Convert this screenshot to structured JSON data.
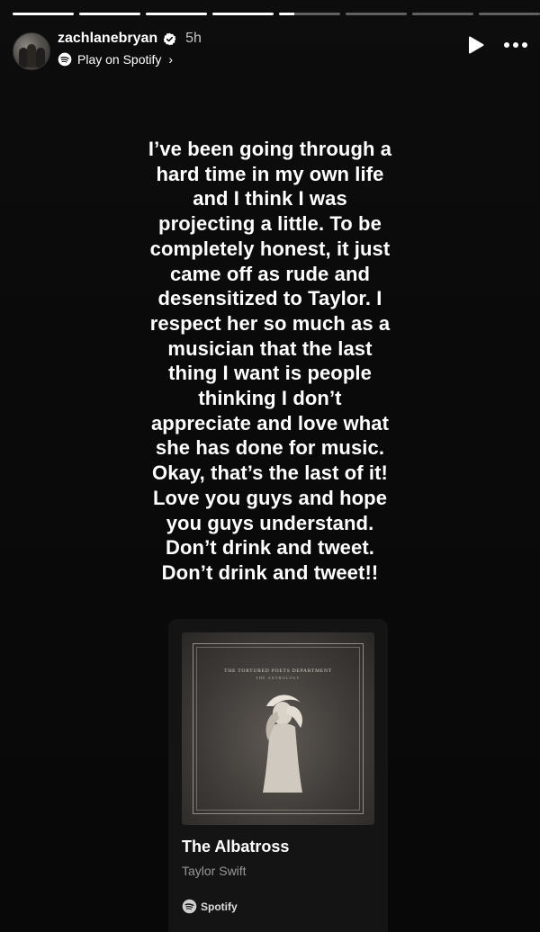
{
  "progress": [
    1,
    1,
    1,
    1,
    0.25,
    0,
    0,
    0
  ],
  "header": {
    "username": "zachlanebryan",
    "time": "5h",
    "music_label": "Play on Spotify",
    "chevron": "›"
  },
  "caption_lines": [
    "I’ve been going through a",
    "hard time in my own life",
    "and I think I was",
    "projecting a little. To be",
    "completely honest, it just",
    "came off as rude and",
    "desensitized to Taylor. I",
    "respect her so much as a",
    "musician that the last",
    "thing I want is people",
    "thinking I don’t",
    "appreciate and love what",
    "she has done for music.",
    "Okay, that’s the last of it!",
    "Love you guys and hope",
    "you guys understand.",
    "Don’t drink and tweet.",
    "Don’t drink and tweet!!"
  ],
  "card": {
    "cover_title": "THE TORTURED POETS DEPARTMENT",
    "cover_subtitle": "THE ANTHOLOGY",
    "song_title": "The Albatross",
    "artist": "Taylor Swift",
    "brand": "Spotify"
  },
  "icons": {
    "verified": "verified-badge-icon",
    "spotify": "spotify-icon",
    "play": "play-icon",
    "more": "more-icon"
  },
  "colors": {
    "background": "#0a0a0a",
    "card": "#141414",
    "text": "#ffffff",
    "muted": "#8c8c8c"
  }
}
